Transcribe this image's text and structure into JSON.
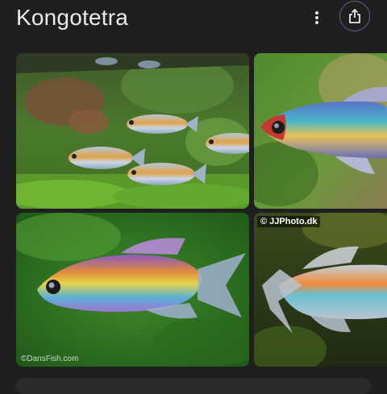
{
  "header": {
    "title": "Kongotetra",
    "more_icon": "more-vert-icon",
    "share_icon": "share-icon"
  },
  "images": [
    {
      "alt": "Kongotetra school in planted aquarium"
    },
    {
      "alt": "Kongotetra close-up red head"
    },
    {
      "alt": "Kongotetra side view",
      "watermark": "©DansFish.com"
    },
    {
      "alt": "Kongotetra long fins",
      "credit": "© JJPhoto.dk"
    }
  ],
  "colors": {
    "background": "#1f1f1f",
    "share_ring": "#6d5f93"
  }
}
